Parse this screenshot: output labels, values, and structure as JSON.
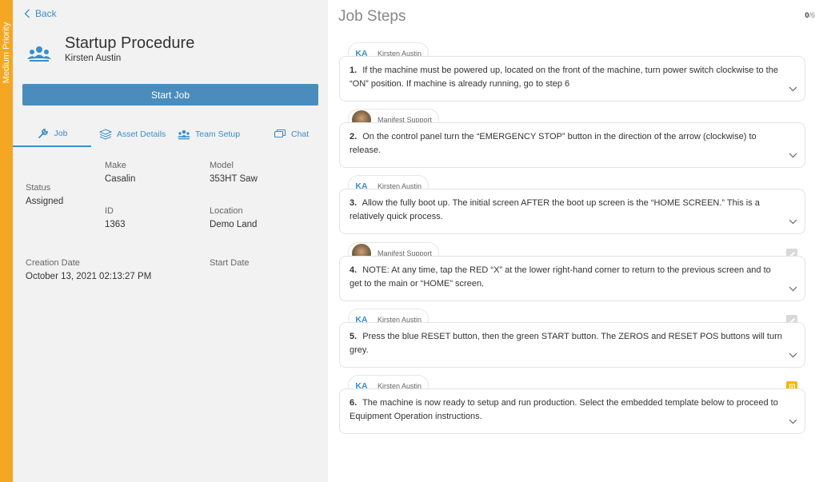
{
  "priority": {
    "label": "Medium Priority",
    "color": "#f5a623"
  },
  "nav": {
    "back_label": "Back"
  },
  "procedure": {
    "title": "Startup Procedure",
    "user": "Kirsten Austin",
    "start_button": "Start Job",
    "icon": "team-icon"
  },
  "tabs": [
    {
      "label": "Job",
      "icon": "wrench-icon"
    },
    {
      "label": "Asset Details",
      "icon": "layers-icon"
    },
    {
      "label": "Team Setup",
      "icon": "team-icon"
    },
    {
      "label": "Chat",
      "icon": "chat-icon"
    }
  ],
  "details": {
    "status_label": "Status",
    "status_value": "Assigned",
    "make_label": "Make",
    "make_value": "Casalin",
    "model_label": "Model",
    "model_value": "353HT Saw",
    "id_label": "ID",
    "id_value": "1363",
    "location_label": "Location",
    "location_value": "Demo Land",
    "creation_label": "Creation Date",
    "creation_value": "October 13, 2021 02:13:27 PM",
    "start_label": "Start Date"
  },
  "steps_panel": {
    "title": "Job Steps",
    "progress_done": "0",
    "progress_total": "/6",
    "steps": [
      {
        "num": "1.",
        "author": "Kirsten Austin",
        "initials": "KA",
        "text": "If the machine must be powered up, located on the front of the machine, turn power switch clockwise to the “ON” position. If machine is already running, go to step 6"
      },
      {
        "num": "2.",
        "author": "Manifest Support",
        "initials": "",
        "text": "On the control panel turn the “EMERGENCY STOP” button in the direction of the arrow (clockwise) to release."
      },
      {
        "num": "3.",
        "author": "Kirsten Austin",
        "initials": "KA",
        "text": "Allow the fully boot up. The initial screen AFTER the boot up screen is the “HOME SCREEN.” This is a relatively quick process."
      },
      {
        "num": "4.",
        "author": "Manifest Support",
        "initials": "",
        "text": "NOTE: At any time, tap the RED “X” at the lower right-hand corner to return to the previous screen and to get to the main or “HOME” screen."
      },
      {
        "num": "5.",
        "author": "Kirsten Austin",
        "initials": "KA",
        "text": "Press the blue RESET button, then the green START button. The ZEROS and RESET POS buttons will turn grey."
      },
      {
        "num": "6.",
        "author": "Kirsten Austin",
        "initials": "KA",
        "text": "The machine is now ready to setup and run production. Select the embedded template below to proceed to Equipment Operation instructions."
      }
    ]
  }
}
